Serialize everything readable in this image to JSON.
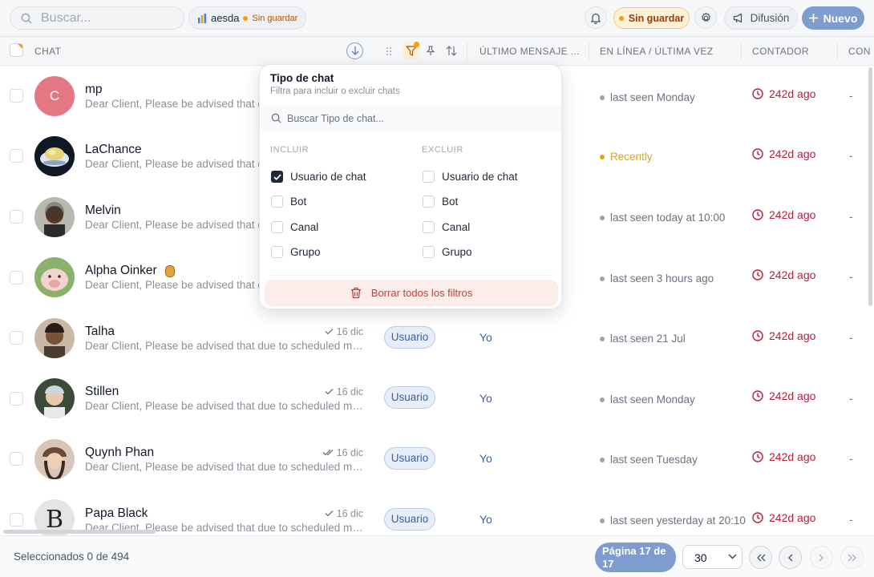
{
  "topbar": {
    "search_placeholder": "Buscar...",
    "workspace_name": "aesda",
    "workspace_status": "Sin guardar",
    "saved_status": "Sin guardar",
    "broadcast_label": "Difusión",
    "new_label": "Nuevo"
  },
  "table": {
    "columns": {
      "chat": "CHAT",
      "last_message": "ÚLTIMO MENSAJE ...",
      "online": "EN LÍNEA / ÚLTIMA VEZ",
      "counter": "CONTADOR",
      "next": "CON"
    },
    "rows": [
      {
        "name": "mp",
        "message": "Dear Client, Please be advised that d",
        "time": "",
        "type": "",
        "owner": "",
        "seen": "last seen Monday",
        "counter": "242d ago",
        "extra": "-"
      },
      {
        "name": "LaChance",
        "message": "Dear Client, Please be advised that d",
        "time": "",
        "type": "",
        "owner": "",
        "seen": "Recently",
        "counter": "242d ago",
        "extra": "-"
      },
      {
        "name": "Melvin",
        "message": "Dear Client, Please be advised that d",
        "time": "",
        "type": "",
        "owner": "",
        "seen": "last seen today at 10:00",
        "counter": "242d ago",
        "extra": "-"
      },
      {
        "name": "Alpha Oinker",
        "message": "Dear Client, Please be advised that d",
        "time": "",
        "type": "",
        "owner": "",
        "seen": "last seen 3 hours ago",
        "counter": "242d ago",
        "extra": "-"
      },
      {
        "name": "Talha",
        "message": "Dear Client, Please be advised that due to scheduled ma...",
        "time": "16 dic",
        "type": "Usuario",
        "owner": "Yo",
        "seen": "last seen 21 Jul",
        "counter": "242d ago",
        "extra": "-"
      },
      {
        "name": "Stillen",
        "message": "Dear Client, Please be advised that due to scheduled ma...",
        "time": "16 dic",
        "type": "Usuario",
        "owner": "Yo",
        "seen": "last seen Monday",
        "counter": "242d ago",
        "extra": "-"
      },
      {
        "name": "Quynh Phan",
        "message": "Dear Client, Please be advised that due to scheduled ma...",
        "time": "16 dic",
        "type": "Usuario",
        "owner": "Yo",
        "seen": "last seen Tuesday",
        "counter": "242d ago",
        "extra": "-"
      },
      {
        "name": "Papa Black",
        "message": "Dear Client, Please be advised that due to scheduled ma...",
        "time": "16 dic",
        "type": "Usuario",
        "owner": "Yo",
        "seen": "last seen yesterday at 20:10",
        "counter": "242d ago",
        "extra": "-"
      }
    ],
    "avatar_letter": "C"
  },
  "filter_popover": {
    "title": "Tipo de chat",
    "subtitle": "Filtra para incluir o excluir chats",
    "search_placeholder": "Buscar Tipo de chat...",
    "include_label": "INCLUIR",
    "exclude_label": "EXCLUIR",
    "options": [
      "Usuario de chat",
      "Bot",
      "Canal",
      "Grupo"
    ],
    "include_checked": [
      true,
      false,
      false,
      false
    ],
    "exclude_checked": [
      false,
      false,
      false,
      false
    ],
    "clear_label": "Borrar todos los filtros"
  },
  "footer": {
    "selection": "Seleccionados 0 de 494",
    "page_label": "Página 17 de 17",
    "per_page": "30"
  },
  "colors": {
    "accent": "#7f9ccf",
    "warning": "#f59e0b",
    "counter_red": "#b91c3c"
  }
}
